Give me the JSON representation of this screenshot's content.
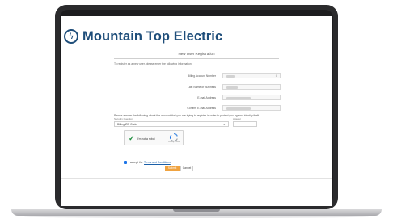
{
  "brand": {
    "name": "Mountain Top Electric",
    "logo_icon": "lightning-bolt-icon",
    "accent_color": "#1f4e7a"
  },
  "page": {
    "title": "New User Registration",
    "intro": "To register as a new user, please enter the following information."
  },
  "form": {
    "fields": [
      {
        "label": "Billing Account Number"
      },
      {
        "label": "Last Name or Business"
      },
      {
        "label": "E-mail Address"
      },
      {
        "label": "Confirm E-mail Address"
      }
    ],
    "security_prompt": "Please answer the following about the account that you are trying to register in order to protect you against identity theft.",
    "security_label": "Security Question",
    "security_selected": "Billing ZIP Code",
    "zip_label": "Answer"
  },
  "captcha": {
    "label": "I'm not a robot",
    "footer": "Privacy - Terms"
  },
  "terms": {
    "text": "I accept the",
    "link": "Terms and Conditions",
    "checked": true
  },
  "buttons": {
    "submit": "Submit",
    "cancel": "Cancel",
    "submit_color": "#f0a340"
  }
}
